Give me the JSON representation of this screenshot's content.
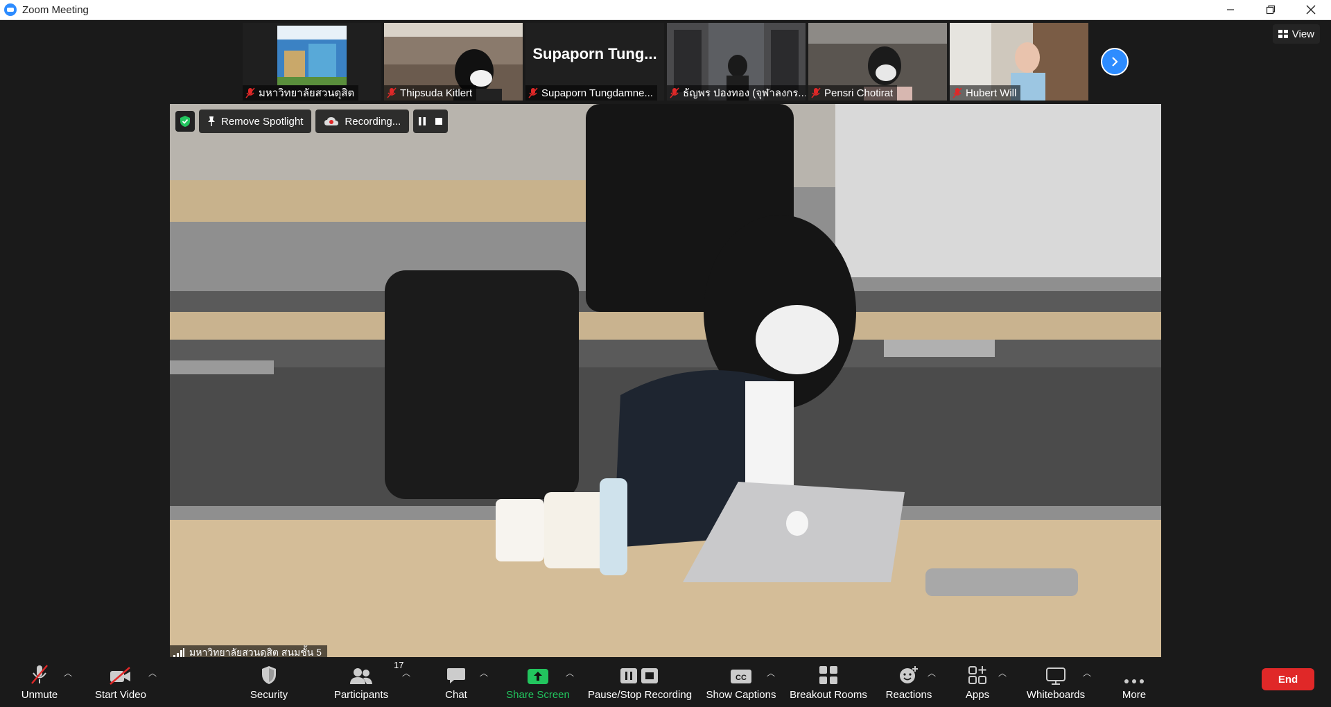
{
  "window": {
    "title": "Zoom Meeting"
  },
  "view_button": "View",
  "thumbnails": [
    {
      "name": "มหาวิทยาลัยสวนดุสิต"
    },
    {
      "name": "Thipsuda Kitlert"
    },
    {
      "name": "Supaporn Tungdamne...",
      "display": "Supaporn Tung..."
    },
    {
      "name": "ธัญพร ปองทอง (จุฬาลงกร..."
    },
    {
      "name": "Pensri Chotirat"
    },
    {
      "name": "Hubert Will"
    }
  ],
  "spotlight": {
    "remove_label": "Remove Spotlight",
    "recording_label": "Recording..."
  },
  "main_speaker": "มหาวิทยาลัยสวนดุสิต สนมชั้น 5",
  "toolbar": {
    "unmute": "Unmute",
    "start_video": "Start Video",
    "security": "Security",
    "participants": "Participants",
    "participants_count": "17",
    "chat": "Chat",
    "share_screen": "Share Screen",
    "pause_stop_recording": "Pause/Stop Recording",
    "show_captions": "Show Captions",
    "breakout_rooms": "Breakout Rooms",
    "reactions": "Reactions",
    "apps": "Apps",
    "whiteboards": "Whiteboards",
    "more": "More",
    "end": "End"
  },
  "colors": {
    "accent": "#2d8cff",
    "end": "#e02828",
    "share": "#22c55e",
    "muted": "#e02828"
  }
}
